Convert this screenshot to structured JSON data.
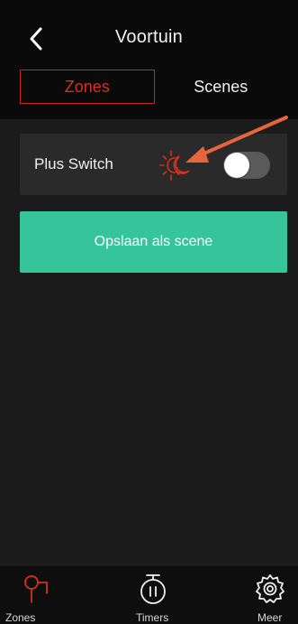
{
  "header": {
    "back_icon": "chevron-left-icon",
    "title": "Voortuin"
  },
  "segments": {
    "tabs": [
      {
        "label": "Zones",
        "active": true
      },
      {
        "label": "Scenes",
        "active": false
      }
    ]
  },
  "zones": [
    {
      "name": "Plus Switch",
      "mode_icon": "day-night-icon",
      "switch_on": false
    }
  ],
  "save_button": {
    "label": "Opslaan als scene"
  },
  "tabbar": {
    "items": [
      {
        "label": "Zones",
        "icon": "zones-icon",
        "active": true
      },
      {
        "label": "Timers",
        "icon": "timer-icon",
        "active": false
      },
      {
        "label": "Meer",
        "icon": "gear-icon",
        "active": false
      }
    ]
  },
  "colors": {
    "accent_red": "#d8301f",
    "save_green": "#36c49a",
    "annotation_arrow": "#e8643c"
  }
}
